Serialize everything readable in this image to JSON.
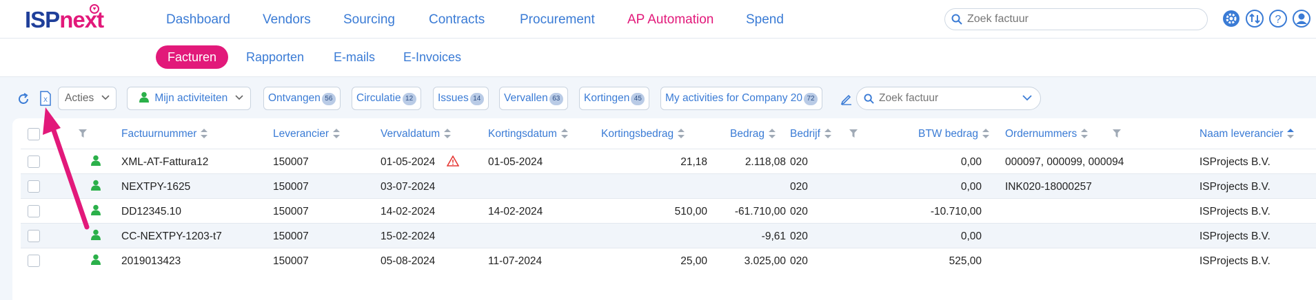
{
  "logo": {
    "part1": "ISP",
    "part2": "next"
  },
  "nav": [
    "Dashboard",
    "Vendors",
    "Sourcing",
    "Contracts",
    "Procurement",
    "AP Automation",
    "Spend"
  ],
  "nav_active": "AP Automation",
  "top_search": {
    "placeholder": "Zoek factuur"
  },
  "top_icons": [
    "gear-icon",
    "transfer-icon",
    "help-icon",
    "user-icon"
  ],
  "subtabs": [
    "Facturen",
    "Rapporten",
    "E-mails",
    "E-Invoices"
  ],
  "subtab_active": "Facturen",
  "toolbar": {
    "acties": "Acties",
    "mijn": "Mijn activiteiten",
    "filters": [
      {
        "label": "Ontvangen",
        "count": "56"
      },
      {
        "label": "Circulatie",
        "count": "12"
      },
      {
        "label": "Issues",
        "count": "14"
      },
      {
        "label": "Vervallen",
        "count": "63"
      },
      {
        "label": "Kortingen",
        "count": "45"
      },
      {
        "label": "My activities for Company 20",
        "count": "72"
      }
    ],
    "search_placeholder": "Zoek factuur"
  },
  "table": {
    "headers": [
      "Factuurnummer",
      "Leverancier",
      "Vervaldatum",
      "Kortingsdatum",
      "Kortingsbedrag",
      "Bedrag",
      "Bedrijf",
      "BTW bedrag",
      "Ordernummers",
      "Naam leverancier"
    ],
    "rows": [
      {
        "factuur": "XML-AT-Fattura12",
        "lev": "150007",
        "verval": "01-05-2024",
        "warn": true,
        "korting_datum": "01-05-2024",
        "korting_bedrag": "21,18",
        "bedrag": "2.118,08",
        "bedrijf": "020",
        "btw": "0,00",
        "order": "000097, 000099, 000094",
        "naam": "ISProjects B.V."
      },
      {
        "factuur": "NEXTPY-1625",
        "lev": "150007",
        "verval": "03-07-2024",
        "warn": false,
        "korting_datum": "",
        "korting_bedrag": "",
        "bedrag": "",
        "bedrijf": "020",
        "btw": "0,00",
        "order": "INK020-18000257",
        "naam": "ISProjects B.V."
      },
      {
        "factuur": "DD12345.10",
        "lev": "150007",
        "verval": "14-02-2024",
        "warn": false,
        "korting_datum": "14-02-2024",
        "korting_bedrag": "510,00",
        "bedrag": "-61.710,00",
        "bedrijf": "020",
        "btw": "-10.710,00",
        "order": "",
        "naam": "ISProjects B.V."
      },
      {
        "factuur": "CC-NEXTPY-1203-t7",
        "lev": "150007",
        "verval": "15-02-2024",
        "warn": false,
        "korting_datum": "",
        "korting_bedrag": "",
        "bedrag": "-9,61",
        "bedrijf": "020",
        "btw": "0,00",
        "order": "",
        "naam": "ISProjects B.V."
      },
      {
        "factuur": "2019013423",
        "lev": "150007",
        "verval": "05-08-2024",
        "warn": false,
        "korting_datum": "11-07-2024",
        "korting_bedrag": "25,00",
        "bedrag": "3.025,00",
        "bedrijf": "020",
        "btw": "525,00",
        "order": "",
        "naam": "ISProjects B.V."
      }
    ]
  },
  "colors": {
    "accent": "#e2197a",
    "link": "#3a7bd5",
    "brand": "#1f3f9a",
    "status_green": "#2bb04a",
    "warning": "#e53935"
  }
}
